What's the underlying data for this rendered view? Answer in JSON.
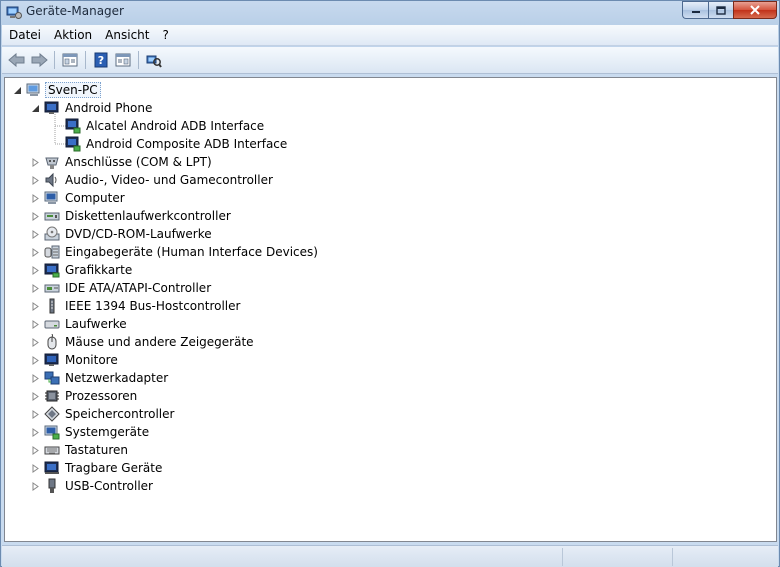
{
  "window": {
    "title": "Geräte-Manager"
  },
  "menu": [
    "Datei",
    "Aktion",
    "Ansicht",
    "?"
  ],
  "tree": {
    "root": "Sven-PC",
    "android": {
      "label": "Android Phone",
      "children": [
        "Alcatel Android ADB Interface",
        "Android Composite ADB Interface"
      ]
    },
    "categories": [
      {
        "label": "Anschlüsse (COM & LPT)",
        "icon": "port-icon"
      },
      {
        "label": "Audio-, Video- und Gamecontroller",
        "icon": "speaker-icon"
      },
      {
        "label": "Computer",
        "icon": "computer-icon"
      },
      {
        "label": "Diskettenlaufwerkcontroller",
        "icon": "floppy-controller-icon"
      },
      {
        "label": "DVD/CD-ROM-Laufwerke",
        "icon": "cdrom-icon"
      },
      {
        "label": "Eingabegeräte (Human Interface Devices)",
        "icon": "hid-icon"
      },
      {
        "label": "Grafikkarte",
        "icon": "display-adapter-icon"
      },
      {
        "label": "IDE ATA/ATAPI-Controller",
        "icon": "ide-controller-icon"
      },
      {
        "label": "IEEE 1394 Bus-Hostcontroller",
        "icon": "firewire-icon"
      },
      {
        "label": "Laufwerke",
        "icon": "disk-drive-icon"
      },
      {
        "label": "Mäuse und andere Zeigegeräte",
        "icon": "mouse-icon"
      },
      {
        "label": "Monitore",
        "icon": "monitor-icon"
      },
      {
        "label": "Netzwerkadapter",
        "icon": "network-adapter-icon"
      },
      {
        "label": "Prozessoren",
        "icon": "processor-icon"
      },
      {
        "label": "Speichercontroller",
        "icon": "storage-controller-icon"
      },
      {
        "label": "Systemgeräte",
        "icon": "system-devices-icon"
      },
      {
        "label": "Tastaturen",
        "icon": "keyboard-icon"
      },
      {
        "label": "Tragbare Geräte",
        "icon": "portable-device-icon"
      },
      {
        "label": "USB-Controller",
        "icon": "usb-icon"
      }
    ]
  },
  "colors": {
    "accent": "#7da2ce",
    "window_frame": "#b6cde6"
  }
}
